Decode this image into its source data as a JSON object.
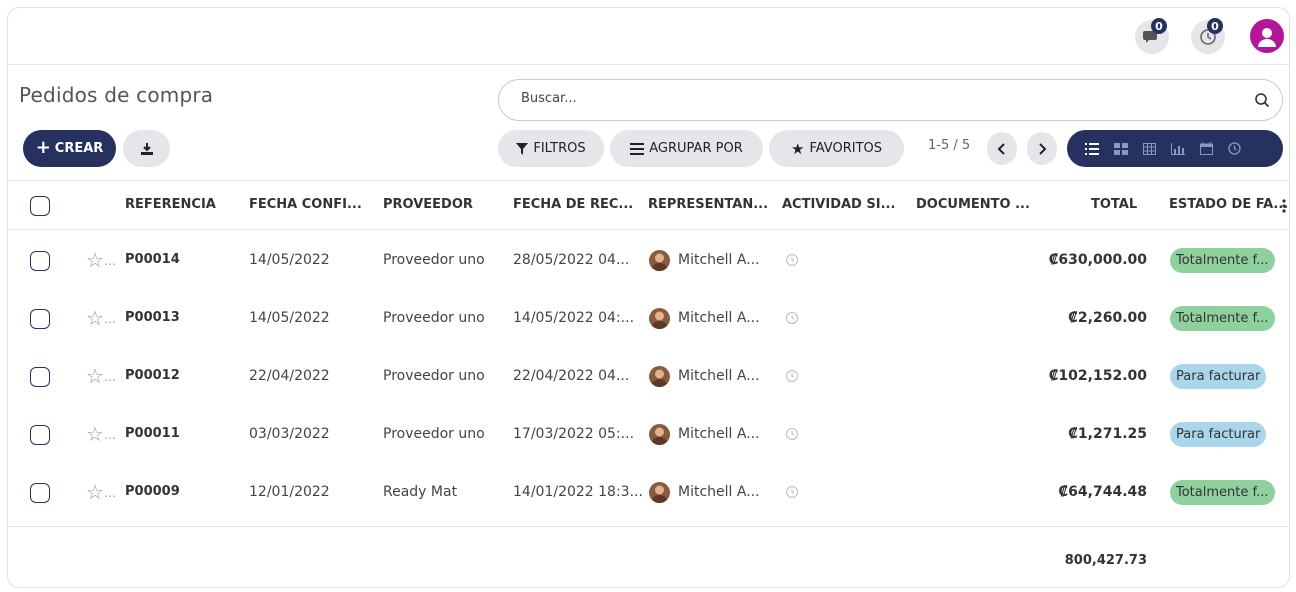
{
  "topbar": {
    "messages_count": "0",
    "activities_count": "0"
  },
  "control": {
    "title": "Pedidos de compra",
    "search_placeholder": "Buscar...",
    "create_label": "CREAR",
    "filters_label": "FILTROS",
    "group_label": "AGRUPAR POR",
    "favorites_label": "FAVORITOS",
    "pager": "1-5 / 5"
  },
  "columns": [
    "REFERENCIA",
    "FECHA CONFI...",
    "PROVEEDOR",
    "FECHA DE REC...",
    "REPRESENTAN...",
    "ACTIVIDAD SI...",
    "DOCUMENTO ...",
    "TOTAL",
    "ESTADO DE FA..."
  ],
  "rows": [
    {
      "ref": "P00014",
      "confirm_date": "14/05/2022",
      "vendor": "Proveedor uno",
      "receipt_date": "28/05/2022 04...",
      "rep": "Mitchell A...",
      "total": "₡630,000.00",
      "status": "Totalmente f...",
      "status_type": "green",
      "trail": "..."
    },
    {
      "ref": "P00013",
      "confirm_date": "14/05/2022",
      "vendor": "Proveedor uno",
      "receipt_date": "14/05/2022 04:...",
      "rep": "Mitchell A...",
      "total": "₡2,260.00",
      "status": "Totalmente f...",
      "status_type": "green",
      "trail": "..."
    },
    {
      "ref": "P00012",
      "confirm_date": "22/04/2022",
      "vendor": "Proveedor uno",
      "receipt_date": "22/04/2022 04...",
      "rep": "Mitchell A...",
      "total": "₡102,152.00",
      "status": "Para facturar",
      "status_type": "blue",
      "trail": ""
    },
    {
      "ref": "P00011",
      "confirm_date": "03/03/2022",
      "vendor": "Proveedor uno",
      "receipt_date": "17/03/2022 05:...",
      "rep": "Mitchell A...",
      "total": "₡1,271.25",
      "status": "Para facturar",
      "status_type": "blue",
      "trail": ""
    },
    {
      "ref": "P00009",
      "confirm_date": "12/01/2022",
      "vendor": "Ready Mat",
      "receipt_date": "14/01/2022 18:3...",
      "rep": "Mitchell A...",
      "total": "₡64,744.48",
      "status": "Totalmente f...",
      "status_type": "green",
      "trail": "..."
    }
  ],
  "footer": {
    "sum_total": "800,427.73"
  },
  "colors": {
    "primary": "#26315f",
    "pill_bg": "#e6e6ea",
    "status_green": "#8fd19e",
    "status_blue": "#a9d6ea",
    "avatar": "#b4169b"
  },
  "icons": [
    "chat-icon",
    "clock-icon",
    "user-avatar-icon",
    "search-icon",
    "download-icon",
    "filter-icon",
    "group-icon",
    "star-icon",
    "chevron-left-icon",
    "chevron-right-icon",
    "list-view-icon",
    "kanban-view-icon",
    "pivot-view-icon",
    "graph-view-icon",
    "calendar-view-icon",
    "activity-view-icon",
    "column-options-icon"
  ]
}
